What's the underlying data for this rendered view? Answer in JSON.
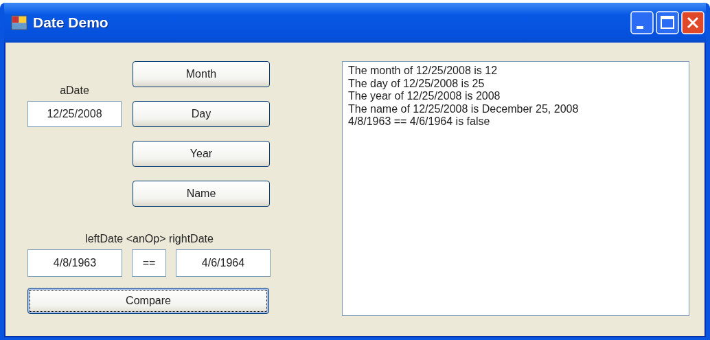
{
  "window": {
    "title": "Date Demo"
  },
  "date_label": "aDate",
  "date_field": {
    "value": "12/25/2008"
  },
  "buttons": [
    {
      "label": "Month",
      "focused": false
    },
    {
      "label": "Day",
      "focused": false
    },
    {
      "label": "Year",
      "focused": false
    },
    {
      "label": "Name",
      "focused": false
    }
  ],
  "compare_label": "leftDate <anOp> rightDate",
  "left_date": {
    "value": "4/8/1963"
  },
  "operator": {
    "value": "=="
  },
  "right_date": {
    "value": "4/6/1964"
  },
  "compare_button": {
    "label": "Compare",
    "focused": true
  },
  "output": [
    "The month of 12/25/2008 is 12",
    "The day of 12/25/2008 is 25",
    "The year of 12/25/2008 is 2008",
    "The name of 12/25/2008 is December 25, 2008",
    "4/8/1963 == 4/6/1964 is false"
  ]
}
